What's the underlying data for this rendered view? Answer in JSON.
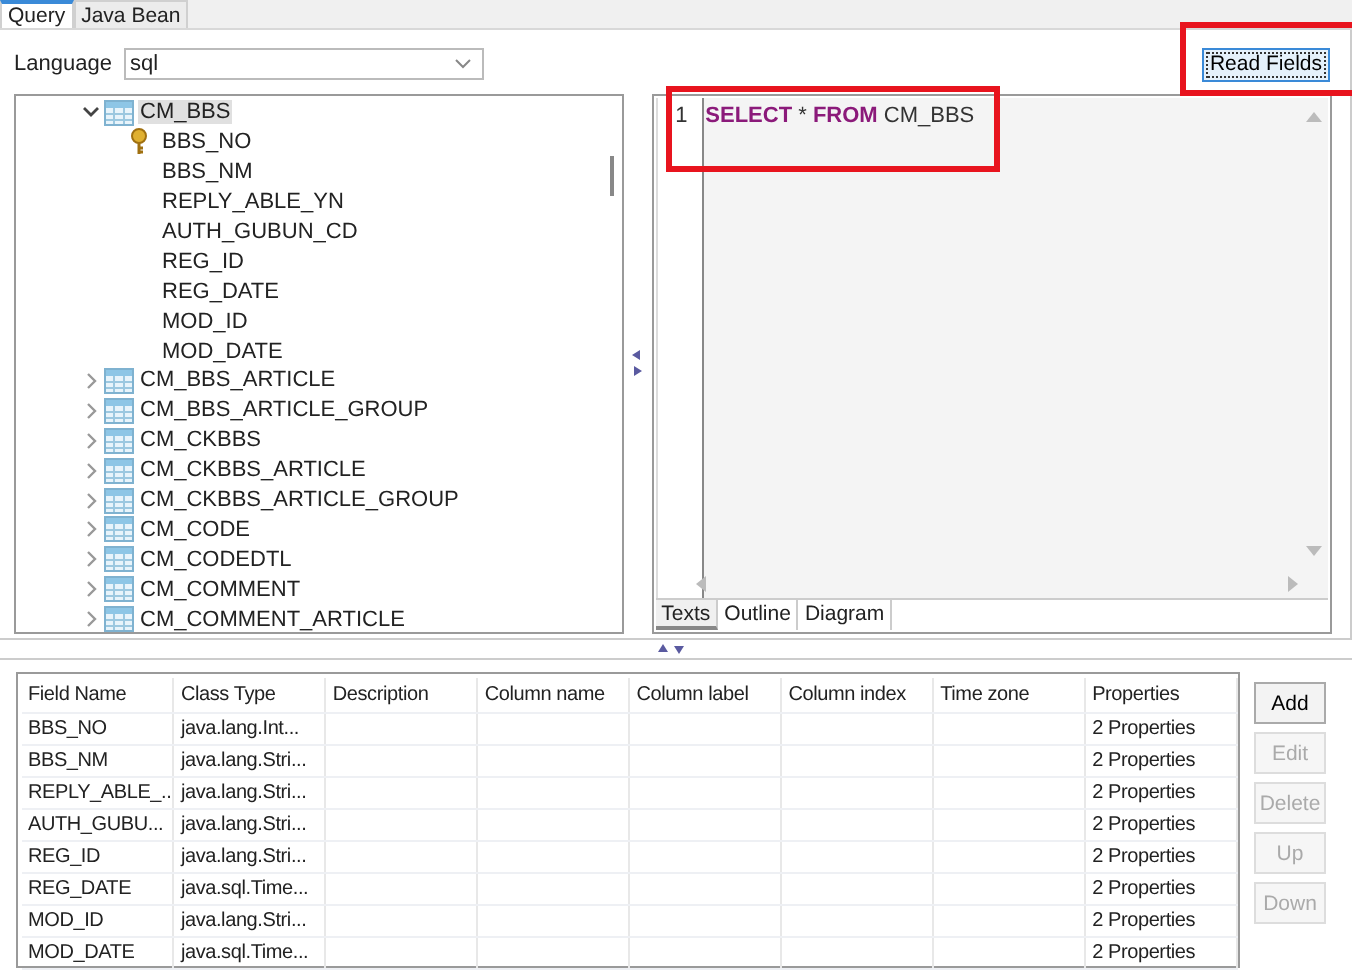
{
  "tabs": [
    {
      "label": "Query",
      "selected": true
    },
    {
      "label": "Java Bean",
      "selected": false
    }
  ],
  "language": {
    "label": "Language",
    "value": "sql"
  },
  "read_fields_button": {
    "label": "Read Fields",
    "focused": true,
    "highlighted": true
  },
  "tree": {
    "items": [
      {
        "label": "CM_BBS",
        "expanded": true,
        "selected": true,
        "children": [
          {
            "label": "BBS_NO",
            "kind": "key"
          },
          {
            "label": "BBS_NM",
            "kind": "column"
          },
          {
            "label": "REPLY_ABLE_YN",
            "kind": "column"
          },
          {
            "label": "AUTH_GUBUN_CD",
            "kind": "column"
          },
          {
            "label": "REG_ID",
            "kind": "column"
          },
          {
            "label": "REG_DATE",
            "kind": "column"
          },
          {
            "label": "MOD_ID",
            "kind": "column"
          },
          {
            "label": "MOD_DATE",
            "kind": "column"
          }
        ]
      },
      {
        "label": "CM_BBS_ARTICLE",
        "expanded": false,
        "selected": false
      },
      {
        "label": "CM_BBS_ARTICLE_GROUP",
        "expanded": false,
        "selected": false
      },
      {
        "label": "CM_CKBBS",
        "expanded": false,
        "selected": false
      },
      {
        "label": "CM_CKBBS_ARTICLE",
        "expanded": false,
        "selected": false
      },
      {
        "label": "CM_CKBBS_ARTICLE_GROUP",
        "expanded": false,
        "selected": false
      },
      {
        "label": "CM_CODE",
        "expanded": false,
        "selected": false
      },
      {
        "label": "CM_CODEDTL",
        "expanded": false,
        "selected": false
      },
      {
        "label": "CM_COMMENT",
        "expanded": false,
        "selected": false
      },
      {
        "label": "CM_COMMENT_ARTICLE",
        "expanded": false,
        "selected": false
      }
    ]
  },
  "editor": {
    "lines": [
      {
        "number": "1",
        "tokens": [
          {
            "text": "SELECT",
            "kind": "keyword"
          },
          {
            "text": "*",
            "kind": "plain"
          },
          {
            "text": "FROM",
            "kind": "keyword"
          },
          {
            "text": "CM_BBS",
            "kind": "plain"
          }
        ]
      }
    ],
    "tabs": [
      {
        "label": "Texts",
        "selected": true
      },
      {
        "label": "Outline",
        "selected": false
      },
      {
        "label": "Diagram",
        "selected": false
      }
    ],
    "highlighted": true
  },
  "table": {
    "columns": [
      "Field Name",
      "Class Type",
      "Description",
      "Column name",
      "Column label",
      "Column index",
      "Time zone",
      "Properties"
    ],
    "rows": [
      [
        "BBS_NO",
        "java.lang.Int...",
        "",
        "",
        "",
        "",
        "",
        "2 Properties"
      ],
      [
        "BBS_NM",
        "java.lang.Stri...",
        "",
        "",
        "",
        "",
        "",
        "2 Properties"
      ],
      [
        "REPLY_ABLE_...",
        "java.lang.Stri...",
        "",
        "",
        "",
        "",
        "",
        "2 Properties"
      ],
      [
        "AUTH_GUBU...",
        "java.lang.Stri...",
        "",
        "",
        "",
        "",
        "",
        "2 Properties"
      ],
      [
        "REG_ID",
        "java.lang.Stri...",
        "",
        "",
        "",
        "",
        "",
        "2 Properties"
      ],
      [
        "REG_DATE",
        "java.sql.Time...",
        "",
        "",
        "",
        "",
        "",
        "2 Properties"
      ],
      [
        "MOD_ID",
        "java.lang.Stri...",
        "",
        "",
        "",
        "",
        "",
        "2 Properties"
      ],
      [
        "MOD_DATE",
        "java.sql.Time...",
        "",
        "",
        "",
        "",
        "",
        "2 Properties"
      ]
    ]
  },
  "side_buttons": [
    {
      "label": "Add",
      "disabled": false
    },
    {
      "label": "Edit",
      "disabled": true
    },
    {
      "label": "Delete",
      "disabled": true
    },
    {
      "label": "Up",
      "disabled": true
    },
    {
      "label": "Down",
      "disabled": true
    }
  ]
}
